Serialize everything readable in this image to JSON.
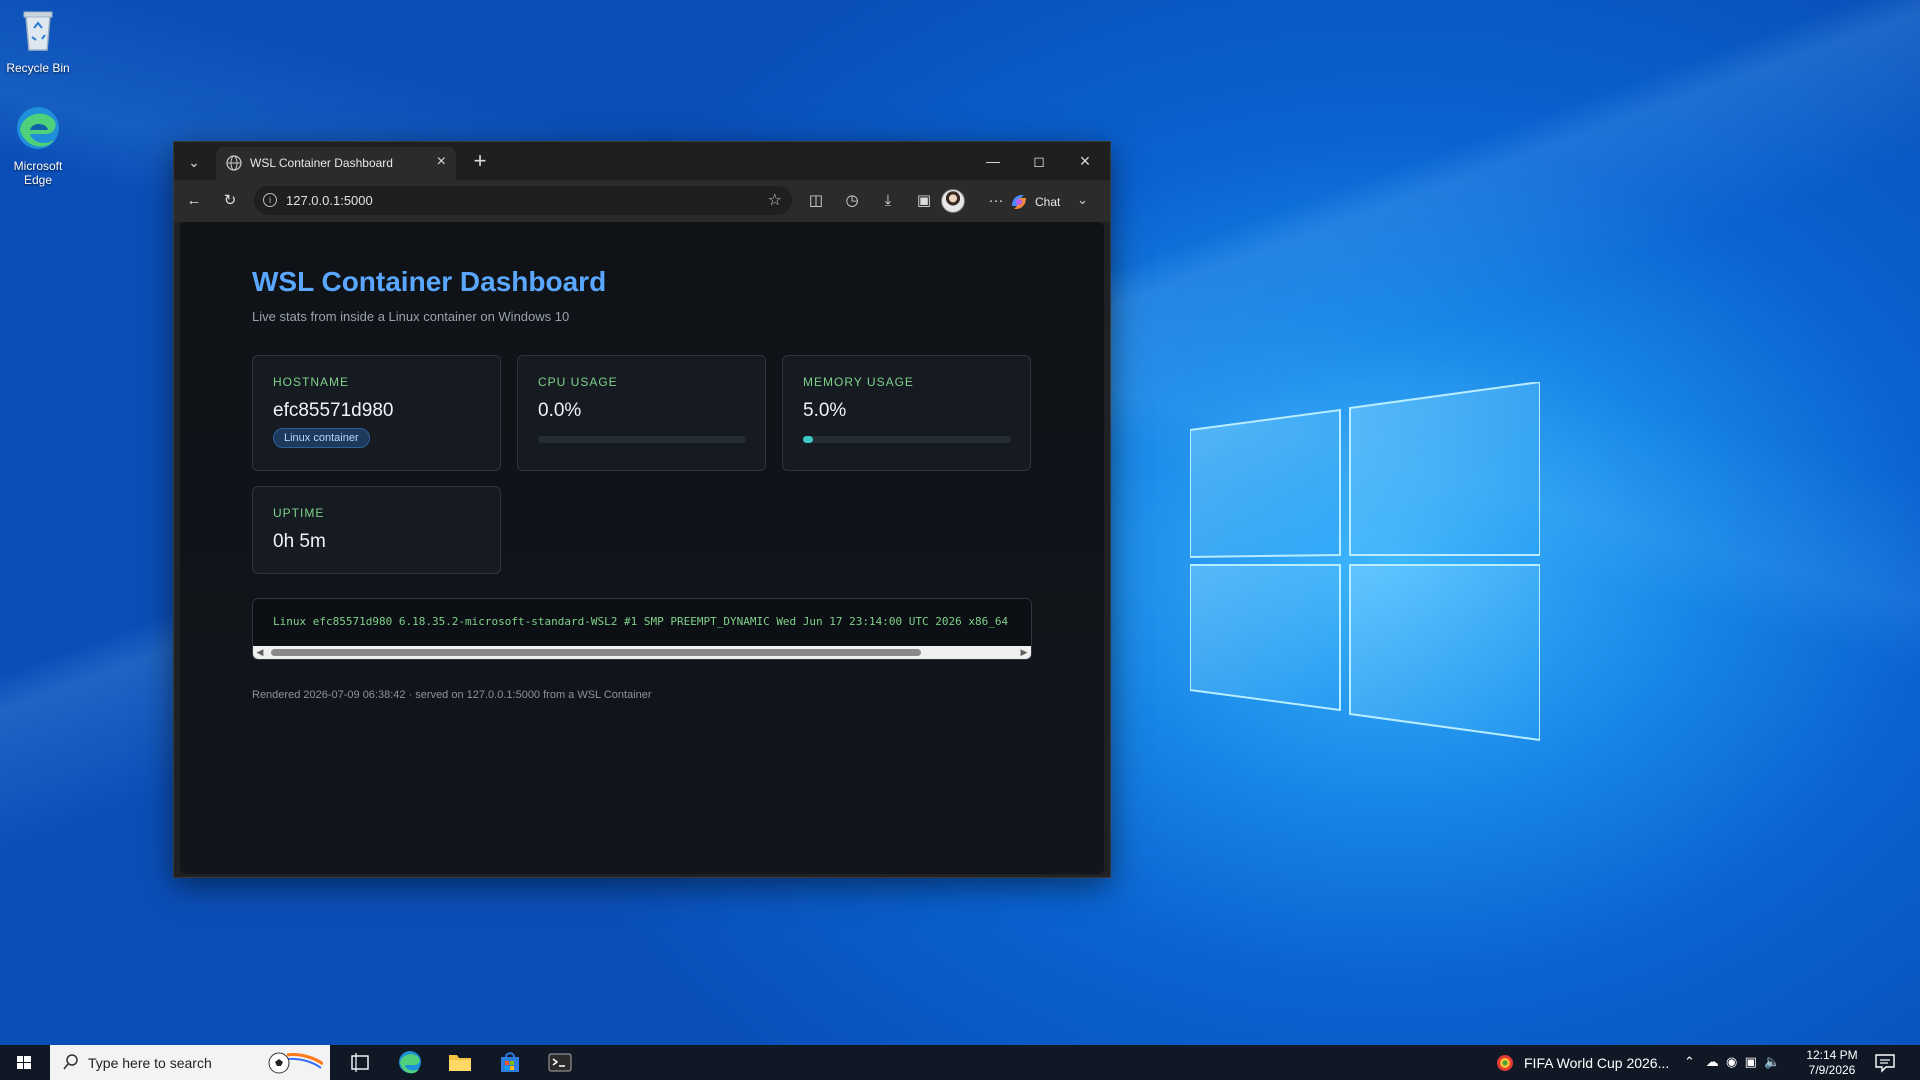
{
  "desktop": {
    "icons": [
      {
        "label": "Recycle Bin"
      },
      {
        "label": "Microsoft Edge"
      }
    ]
  },
  "browser": {
    "tab_title": "WSL Container Dashboard",
    "url": "127.0.0.1:5000",
    "chat_label": "Chat"
  },
  "page": {
    "title": "WSL Container Dashboard",
    "subtitle": "Live stats from inside a Linux container on Windows 10",
    "cards": {
      "hostname": {
        "label": "HOSTNAME",
        "value": "efc85571d980",
        "badge": "Linux container"
      },
      "cpu": {
        "label": "CPU USAGE",
        "value": "0.0%",
        "percent": 0.0
      },
      "memory": {
        "label": "MEMORY USAGE",
        "value": "5.0%",
        "percent": 5.0
      },
      "uptime": {
        "label": "UPTIME",
        "value": "0h 5m"
      }
    },
    "uname": "Linux efc85571d980 6.18.35.2-microsoft-standard-WSL2 #1 SMP PREEMPT_DYNAMIC Wed Jun 17 23:14:00 UTC 2026 x86_64",
    "footer": "Rendered 2026-07-09 06:38:42 · served on 127.0.0.1:5000 from a WSL Container"
  },
  "taskbar": {
    "search_placeholder": "Type here to search",
    "news": "FIFA World Cup 2026...",
    "time": "12:14 PM",
    "date": "7/9/2026"
  },
  "colors": {
    "accent_blue": "#5aa7ff",
    "label_green": "#7fd18a",
    "bar_teal": "#3ec6c6"
  }
}
